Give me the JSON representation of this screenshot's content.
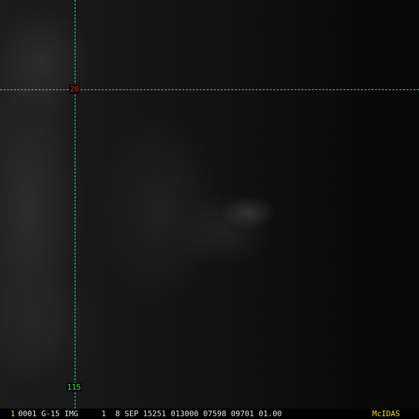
{
  "display": {
    "frame_number": "1",
    "status_line": "0001 G-15 IMG     1  8 SEP 15251 013000 07598 09701 01.00",
    "brand": "McIDAS"
  },
  "grid": {
    "latitude_label": "20",
    "longitude_label": "115"
  },
  "colors": {
    "grid_line": "#2fd4e0",
    "latitude_label": "#e01818",
    "longitude_label": "#2ee83a",
    "frame_number": "#f0e000",
    "brand": "#f0e000",
    "status_text": "#e8e8e8",
    "background": "#0b0b0b"
  }
}
